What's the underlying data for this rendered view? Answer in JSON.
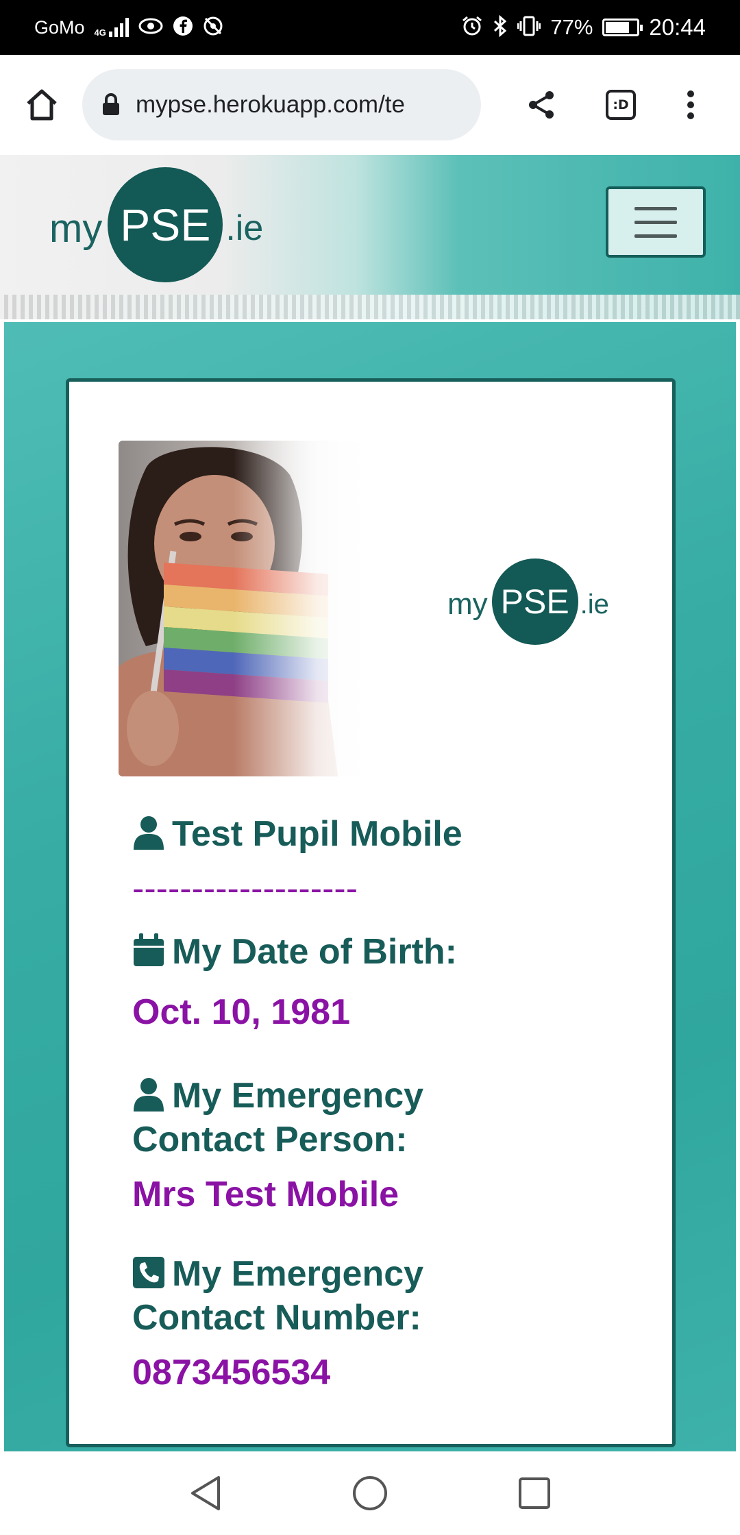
{
  "status_bar": {
    "carrier": "GoMo",
    "network": "4G",
    "battery_percent": "77%",
    "battery_level": 0.77,
    "time": "20:44",
    "icons": [
      "signal-icon",
      "eye-icon",
      "facebook-icon",
      "location-off-icon",
      "alarm-icon",
      "bluetooth-icon",
      "vibrate-icon",
      "battery-icon"
    ]
  },
  "browser": {
    "url": "mypse.herokuapp.com/te",
    "icons": [
      "home-icon",
      "lock-icon",
      "share-icon",
      "tabs-icon",
      "more-vert-icon"
    ],
    "tabs_glyph": ":D"
  },
  "header": {
    "logo": {
      "prefix": "my",
      "brand": "PSE",
      "suffix": ".ie"
    },
    "menu_icon": "hamburger-icon"
  },
  "card": {
    "logo": {
      "prefix": "my",
      "brand": "PSE",
      "suffix": ".ie"
    },
    "photo": "pupil-with-rainbow-flag-photo",
    "name": "Test Pupil Mobile",
    "divider": "-------------------",
    "dob_label": "My Date of Birth:",
    "dob_value": "Oct. 10, 1981",
    "contact_person_label_1": "My Emergency",
    "contact_person_label_2": "Contact Person:",
    "contact_person_value": "Mrs Test Mobile",
    "contact_number_label_1": "My Emergency",
    "contact_number_label_2": "Contact Number:",
    "contact_number_value": "0873456534",
    "icons": [
      "user-icon",
      "calendar-icon",
      "user-icon",
      "phone-icon"
    ]
  },
  "colors": {
    "brand_dark": "#135955",
    "heading_text": "#175c58",
    "value_text": "#8a12a4",
    "teal_bg": "#36aca4"
  },
  "android_nav": {
    "icons": [
      "back-icon",
      "home-circle-icon",
      "recents-icon"
    ]
  }
}
